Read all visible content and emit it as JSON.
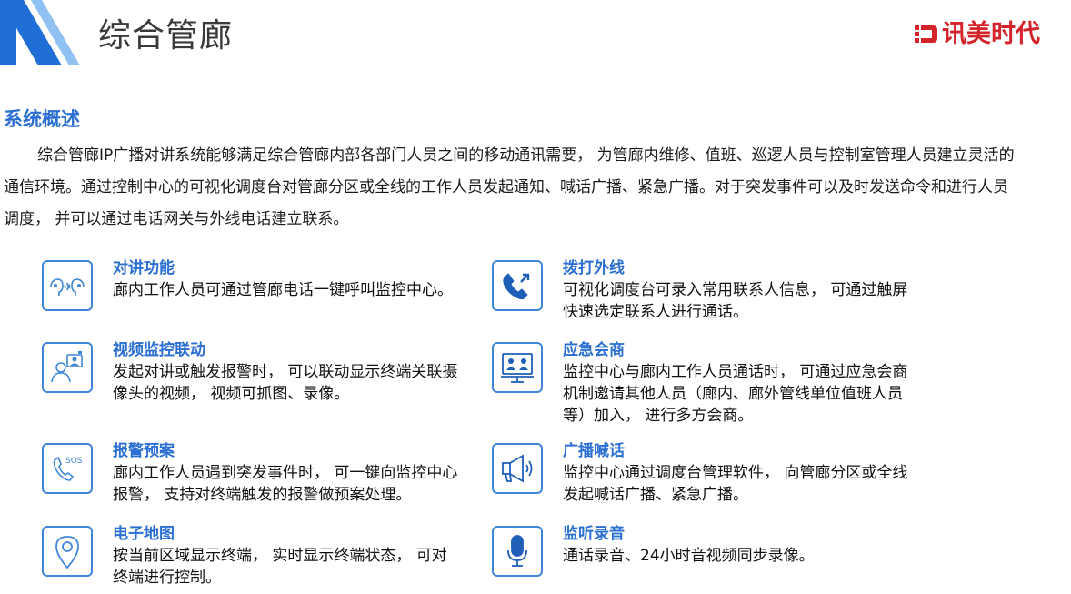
{
  "header": {
    "title": "综合管廊"
  },
  "logo": {
    "text": "讯美时代",
    "color": "#d4232a"
  },
  "overview": {
    "title": "系统概述",
    "text": "综合管廊IP广播对讲系统能够满足综合管廊内部各部门人员之间的移动通讯需要， 为管廊内维修、值班、巡逻人员与控制室管理人员建立灵活的通信环境。通过控制中心的可视化调度台对管廊分区或全线的工作人员发起通知、喊话广播、紧急广播。对于突发事件可以及时发送命令和进行人员调度， 并可以通过电话网关与外线电话建立联系。"
  },
  "features": {
    "intercom": {
      "title": "对讲功能",
      "desc": "廊内工作人员可通过管廊电话一键呼叫监控中心。",
      "icon": "intercom-icon"
    },
    "outcall": {
      "title": "拨打外线",
      "desc": "可视化调度台可录入常用联系人信息， 可通过触屏快速选定联系人进行通话。",
      "icon": "phone-call-icon"
    },
    "video": {
      "title": "视频监控联动",
      "desc": "发起对讲或触发报警时， 可以联动显示终端关联摄像头的视频， 视频可抓图、录像。",
      "icon": "video-monitor-icon"
    },
    "conference": {
      "title": "应急会商",
      "desc": "监控中心与廊内工作人员通话时， 可通过应急会商机制邀请其他人员（廊内、廊外管线单位值班人员等）加入， 进行多方会商。",
      "icon": "conference-icon"
    },
    "alarm": {
      "title": "报警预案",
      "desc": "廊内工作人员遇到突发事件时， 可一键向监控中心报警， 支持对终端触发的报警做预案处理。",
      "icon": "sos-phone-icon"
    },
    "broadcast": {
      "title": "广播喊话",
      "desc": "监控中心通过调度台管理软件， 向管廊分区或全线发起喊话广播、紧急广播。",
      "icon": "megaphone-icon"
    },
    "map": {
      "title": "电子地图",
      "desc": "按当前区域显示终端， 实时显示终端状态， 可对终端进行控制。",
      "icon": "map-pin-icon"
    },
    "recording": {
      "title": "监听录音",
      "desc": "通话录音、24小时音视频同步录像。",
      "icon": "microphone-icon"
    }
  },
  "colors": {
    "accent": "#2a6fd1",
    "icon_border": "#3f86d6",
    "logo_red": "#d4232a"
  }
}
